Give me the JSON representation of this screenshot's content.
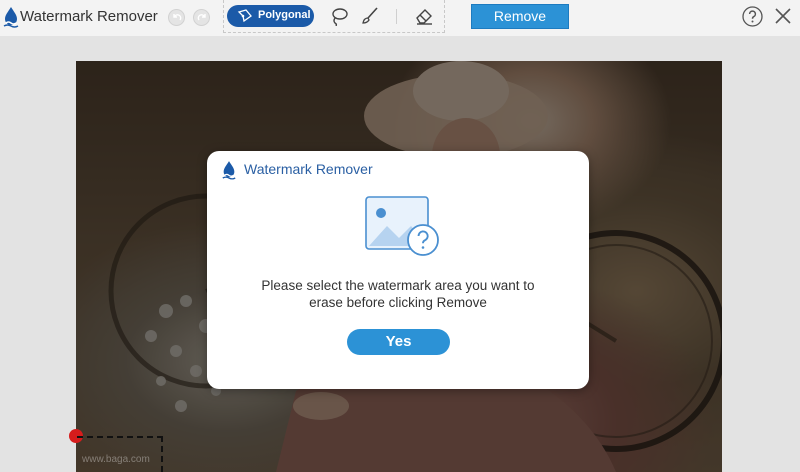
{
  "app": {
    "title": "Watermark Remover",
    "brand_color": "#1b5aa8",
    "accent_color": "#2c92d6"
  },
  "toolbar": {
    "undo_icon": "undo-icon",
    "redo_icon": "redo-icon",
    "tools": {
      "polygonal_label": "Polygonal",
      "polygonal_icon": "polygon-select-icon",
      "lasso_icon": "lasso-icon",
      "brush_icon": "brush-icon",
      "eraser_icon": "eraser-icon"
    },
    "remove_label": "Remove",
    "help_icon": "help-icon",
    "close_icon": "close-icon"
  },
  "canvas": {
    "photo": "photo-of-woman-with-hat-and-bicycle",
    "watermark_text": "www.baga.com"
  },
  "dialog": {
    "title": "Watermark Remover",
    "illustration": "image-question-icon",
    "message": "Please select the watermark area you want to\nerase before clicking Remove",
    "yes_label": "Yes"
  }
}
